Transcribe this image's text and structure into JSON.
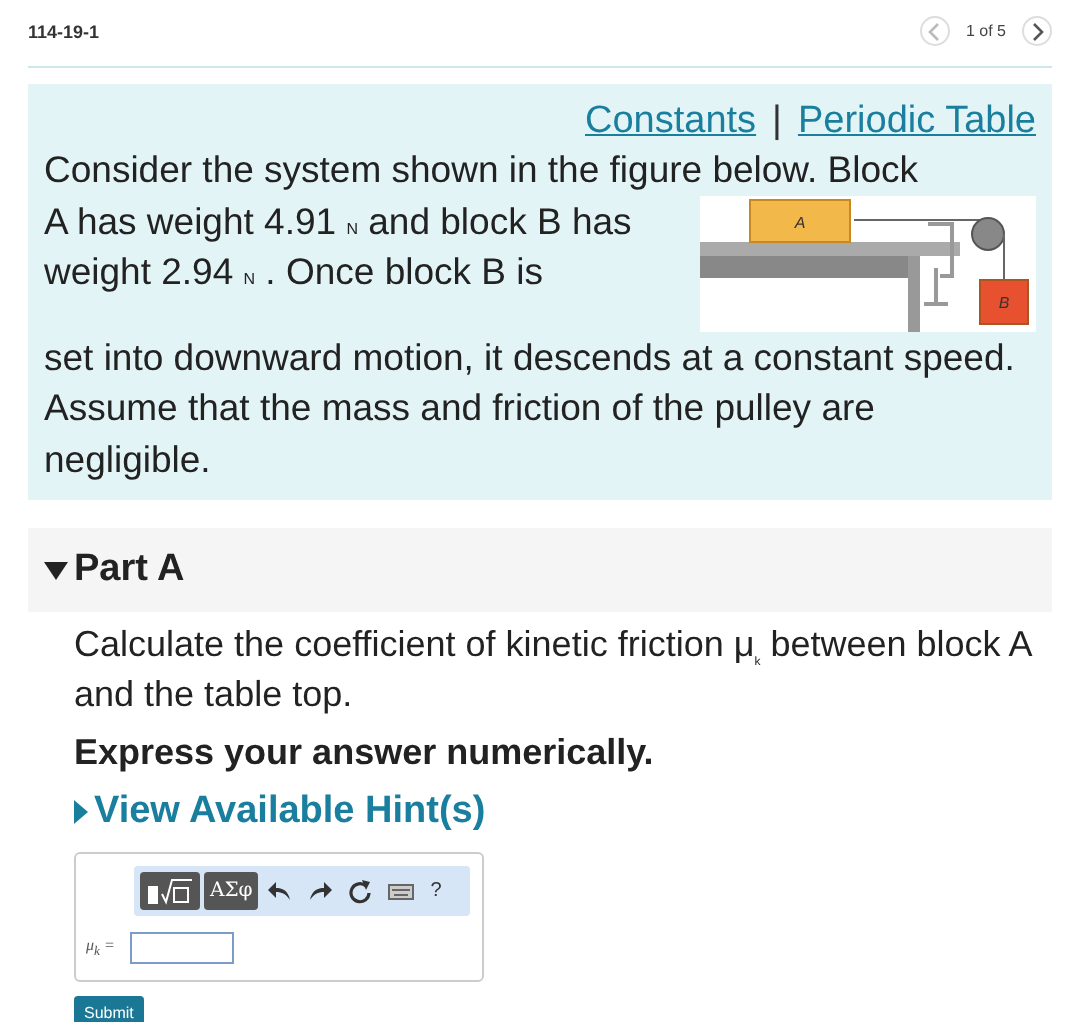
{
  "header": {
    "problem_id": "114-19-1",
    "pager": "1 of 5"
  },
  "links": [
    "Constants",
    "Periodic Table"
  ],
  "link_separator": "|",
  "figure": {
    "labels": [
      "A",
      "B"
    ]
  },
  "problem_text": [
    "Consider the system shown in the figure below. Block",
    "A has weight 4.91 $_{N}$ and block B has weight 2.94 $_{N}$ . Once block B is",
    "set into downward motion, it descends at a constant speed. Assume that the mass and friction of the pulley are negligible."
  ],
  "part": {
    "title": "Part A",
    "expanded": true
  },
  "question": "Calculate the coefficient of kinetic friction μ$_{k}$ between block A and the table top.",
  "instruction": "Express your answer numerically.",
  "hint_link": "View Available Hint(s)",
  "toolbar": {
    "symbols_button": "ΑΣφ",
    "help_button": "?"
  },
  "answer": {
    "label": "μ$_{k}$ ="
  },
  "submit": "Submit"
}
